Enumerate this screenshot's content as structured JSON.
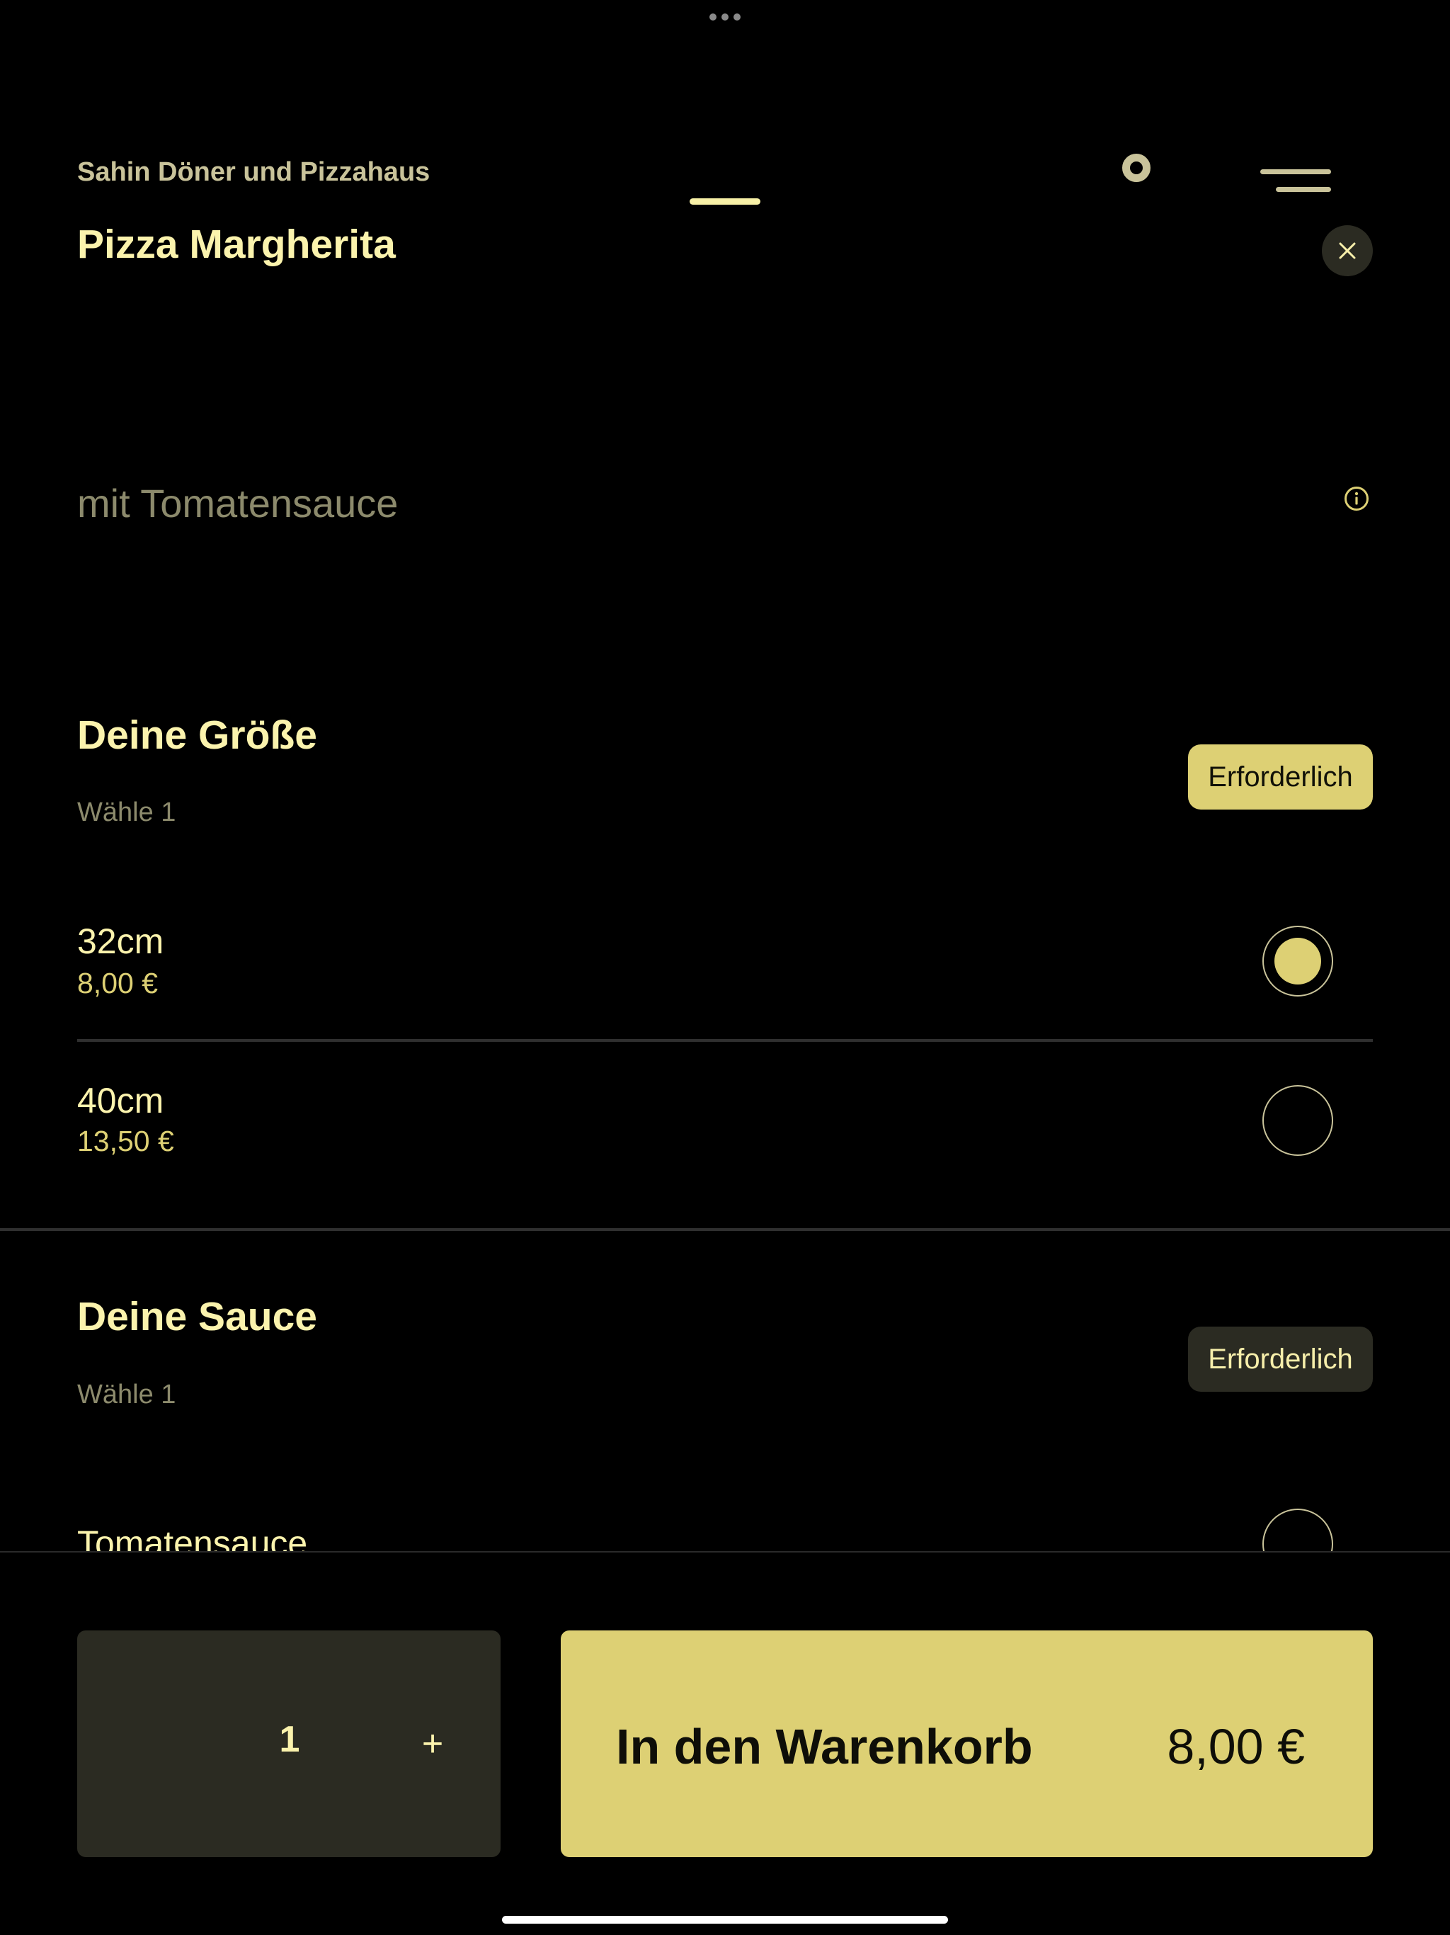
{
  "restaurant": {
    "name": "Sahin Döner und Pizzahaus"
  },
  "product": {
    "title": "Pizza Margherita",
    "description": "mit Tomatensauce"
  },
  "icons": {
    "close": "close-icon",
    "info": "info-icon",
    "menu": "menu-icon",
    "profile": "ring-icon",
    "plus": "plus-icon"
  },
  "sections": [
    {
      "title": "Deine Größe",
      "subtitle": "Wähle 1",
      "badge": "Erforderlich",
      "badge_state": "active",
      "options": [
        {
          "label": "32cm",
          "price": "8,00 €",
          "selected": true
        },
        {
          "label": "40cm",
          "price": "13,50 €",
          "selected": false
        }
      ]
    },
    {
      "title": "Deine Sauce",
      "subtitle": "Wähle 1",
      "badge": "Erforderlich",
      "badge_state": "inactive",
      "options": [
        {
          "label": "Tomatensauce",
          "selected": false
        }
      ]
    }
  ],
  "footer": {
    "quantity": "1",
    "plus_label": "+",
    "cart_label": "In den Warenkorb",
    "cart_price": "8,00 €"
  },
  "colors": {
    "background": "#000000",
    "accent": "#ddd074",
    "title_text": "#fbf3ad",
    "muted_text": "#8c8a6c",
    "surface": "#2b2b22"
  }
}
